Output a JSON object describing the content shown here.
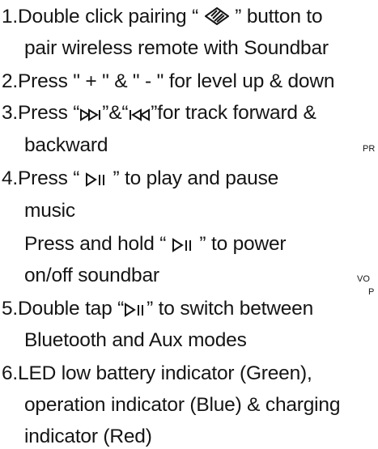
{
  "lines": [
    {
      "a": "1.Double click pairing “ ",
      "b": " ”  button to"
    },
    {
      "t": "pair wireless remote with Soundbar"
    },
    {
      "t": "2.Press \" + \" & \" - \" for level up & down"
    },
    {
      "a": "3.Press “",
      "b": "”&“",
      "c": "”for track forward &"
    },
    {
      "t": "backward"
    },
    {
      "a": "4.Press “ ",
      "b": " ” to play and pause"
    },
    {
      "t": "music"
    },
    {
      "a": "Press and hold “ ",
      "b": " ” to power"
    },
    {
      "t": "on/off soundbar"
    },
    {
      "a": "5.Double tap “",
      "b": "” to switch between"
    },
    {
      "t": "Bluetooth and Aux modes"
    },
    {
      "t": "6.LED low battery indicator (Green),"
    },
    {
      "t": "operation indicator (Blue) & charging"
    },
    {
      "t": "indicator (Red)"
    }
  ],
  "side_labels": [
    "PR",
    "VO",
    "P"
  ],
  "icons": [
    "pairing-icon",
    "track-forward-icon",
    "track-backward-icon",
    "play-pause-icon"
  ]
}
